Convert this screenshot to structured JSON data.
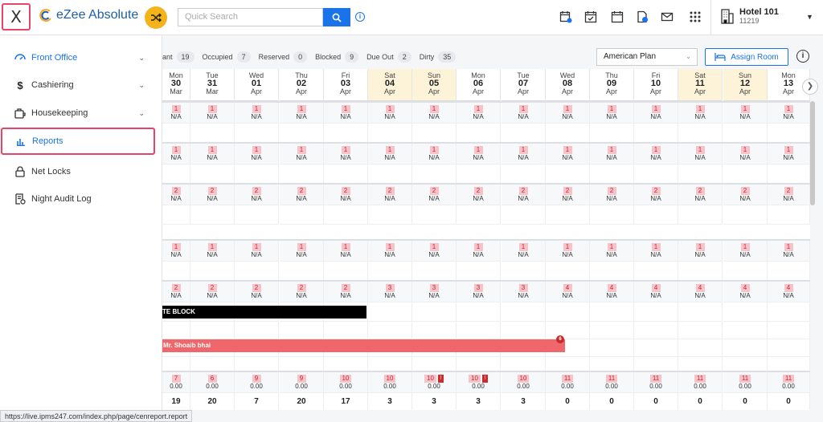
{
  "header": {
    "close_label": "X",
    "app_name": "eZee Absolute",
    "search_placeholder": "Quick Search",
    "info_label": "i",
    "hotel_name": "Hotel 101",
    "hotel_code": "11219"
  },
  "sidebar": {
    "items": [
      {
        "label": "Front Office",
        "icon": "dashboard-icon",
        "chevron": true,
        "active": true
      },
      {
        "label": "Cashiering",
        "icon": "dollar-icon",
        "chevron": true
      },
      {
        "label": "Housekeeping",
        "icon": "housekeeping-icon",
        "chevron": true
      },
      {
        "label": "Reports",
        "icon": "bar-chart-icon",
        "chevron": false,
        "highlighted": true
      },
      {
        "label": "Net Locks",
        "icon": "lock-icon",
        "chevron": false
      },
      {
        "label": "Night Audit Log",
        "icon": "audit-log-icon",
        "chevron": false
      }
    ]
  },
  "stats": [
    {
      "label": "ant",
      "count": "19"
    },
    {
      "label": "Occupied",
      "count": "7"
    },
    {
      "label": "Reserved",
      "count": "0"
    },
    {
      "label": "Blocked",
      "count": "9"
    },
    {
      "label": "Due Out",
      "count": "2"
    },
    {
      "label": "Dirty",
      "count": "35"
    }
  ],
  "plan": {
    "selected": "American Plan"
  },
  "assign_room_label": "Assign Room",
  "days": [
    {
      "dow": "Mon",
      "d": "30",
      "m": "Mar",
      "we": false
    },
    {
      "dow": "Tue",
      "d": "31",
      "m": "Mar",
      "we": false
    },
    {
      "dow": "Wed",
      "d": "01",
      "m": "Apr",
      "we": false
    },
    {
      "dow": "Thu",
      "d": "02",
      "m": "Apr",
      "we": false
    },
    {
      "dow": "Fri",
      "d": "03",
      "m": "Apr",
      "we": false
    },
    {
      "dow": "Sat",
      "d": "04",
      "m": "Apr",
      "we": true
    },
    {
      "dow": "Sun",
      "d": "05",
      "m": "Apr",
      "we": true
    },
    {
      "dow": "Mon",
      "d": "06",
      "m": "Apr",
      "we": false
    },
    {
      "dow": "Tue",
      "d": "07",
      "m": "Apr",
      "we": false
    },
    {
      "dow": "Wed",
      "d": "08",
      "m": "Apr",
      "we": false
    },
    {
      "dow": "Thu",
      "d": "09",
      "m": "Apr",
      "we": false
    },
    {
      "dow": "Fri",
      "d": "10",
      "m": "Apr",
      "we": false
    },
    {
      "dow": "Sat",
      "d": "11",
      "m": "Apr",
      "we": true
    },
    {
      "dow": "Sun",
      "d": "12",
      "m": "Apr",
      "we": true
    },
    {
      "dow": "Mon",
      "d": "13",
      "m": "Apr",
      "we": false
    }
  ],
  "avail_rows": [
    [
      "1",
      "1",
      "1",
      "1",
      "1",
      "1",
      "1",
      "1",
      "1",
      "1",
      "1",
      "1",
      "1",
      "1",
      "1"
    ],
    [
      "1",
      "1",
      "1",
      "1",
      "1",
      "1",
      "1",
      "1",
      "1",
      "1",
      "1",
      "1",
      "1",
      "1",
      "1"
    ],
    [
      "2",
      "2",
      "2",
      "2",
      "2",
      "2",
      "2",
      "2",
      "2",
      "2",
      "2",
      "2",
      "2",
      "2",
      "2"
    ],
    [
      "1",
      "1",
      "1",
      "1",
      "1",
      "1",
      "1",
      "1",
      "1",
      "1",
      "1",
      "1",
      "1",
      "1",
      "1"
    ],
    [
      "2",
      "2",
      "2",
      "2",
      "2",
      "3",
      "3",
      "3",
      "3",
      "4",
      "4",
      "4",
      "4",
      "4",
      "4"
    ]
  ],
  "na": "N/A",
  "block_label": "TE BLOCK",
  "reservation": {
    "guest": "Mr. Shoaib bhai",
    "count": "6"
  },
  "summary": {
    "top": [
      "7",
      "6",
      "9",
      "9",
      "10",
      "10",
      "10",
      "10",
      "10",
      "11",
      "11",
      "11",
      "11",
      "11",
      "11"
    ],
    "warn": [
      false,
      false,
      false,
      false,
      false,
      false,
      true,
      true,
      false,
      false,
      false,
      false,
      false,
      false,
      false
    ],
    "warn_label": "!",
    "amount": "0.00",
    "totals": [
      "19",
      "20",
      "7",
      "20",
      "17",
      "3",
      "3",
      "3",
      "3",
      "0",
      "0",
      "0",
      "0",
      "0",
      "0"
    ]
  },
  "status_url": "https://live.ipms247.com/index.php/page/cenreport.report",
  "colors": {
    "accent": "#1a73e8",
    "highlight": "#e8456b",
    "weekend": "#fdf3d9",
    "block": "#000000",
    "reservation": "#f0676b"
  }
}
